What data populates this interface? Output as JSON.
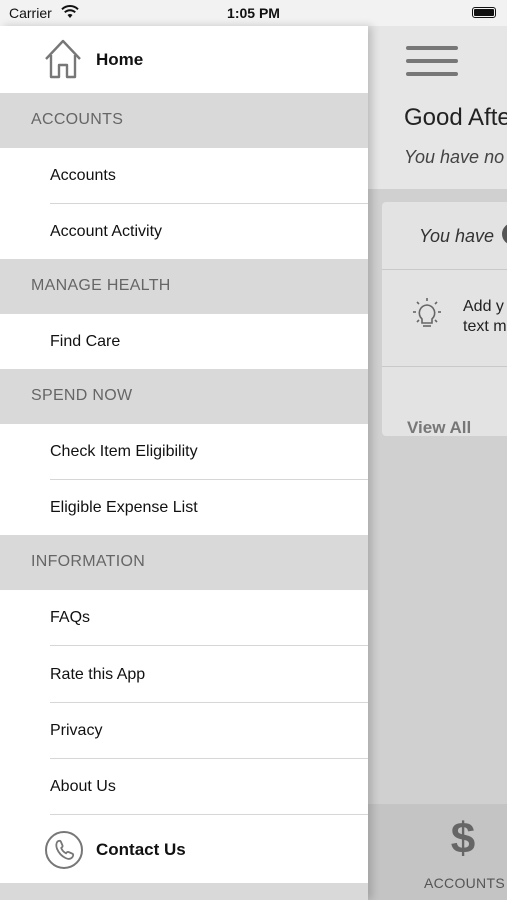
{
  "status_bar": {
    "carrier": "Carrier",
    "time": "1:05 PM"
  },
  "background_app": {
    "greeting": "Good Afte",
    "subgreeting": "You have no",
    "card_text": "You have",
    "tip_line1": "Add y",
    "tip_line2": "text m",
    "view_all": "View All",
    "tab_icon": "$",
    "tab_label": "ACCOUNTS"
  },
  "drawer": {
    "home_label": "Home",
    "sections": [
      {
        "title": "ACCOUNTS",
        "items": [
          "Accounts",
          "Account Activity"
        ]
      },
      {
        "title": "MANAGE HEALTH",
        "items": [
          "Find Care"
        ]
      },
      {
        "title": "SPEND NOW",
        "items": [
          "Check Item Eligibility",
          "Eligible Expense List"
        ]
      },
      {
        "title": "INFORMATION",
        "items": [
          "FAQs",
          "Rate this App",
          "Privacy",
          "About Us"
        ]
      }
    ],
    "contact_label": "Contact Us"
  }
}
